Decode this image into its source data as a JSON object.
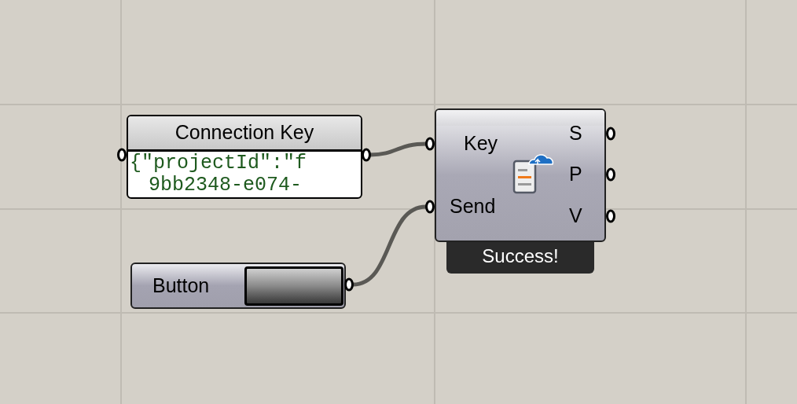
{
  "panel": {
    "title": "Connection Key",
    "lines": [
      "{\"projectId\":\"f",
      "9bb2348-e074-"
    ]
  },
  "component": {
    "inputs": [
      {
        "label": "Key"
      },
      {
        "label": "Send"
      }
    ],
    "outputs": [
      {
        "label": "S"
      },
      {
        "label": "P"
      },
      {
        "label": "V"
      }
    ],
    "message": "Success!"
  },
  "button_node": {
    "label": "Button"
  }
}
